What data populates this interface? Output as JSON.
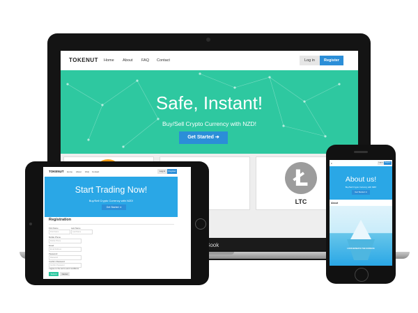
{
  "laptop": {
    "brand": "TOKENUT",
    "nav": [
      "Home",
      "About",
      "FAQ",
      "Contact"
    ],
    "login": "Log in",
    "register": "Register",
    "hero_title": "Safe, Instant!",
    "hero_subtitle": "Buy/Sell Crypto Currency with NZD!",
    "cta": "Get Started ➔",
    "coin_label": "LTC",
    "coin_glyph": "Ł",
    "bottom_text": "Book"
  },
  "tablet": {
    "brand": "TOKENUT",
    "nav": [
      "Home",
      "About",
      "FAQ",
      "Contact"
    ],
    "login": "Log in",
    "register": "Register",
    "hero_title": "Start Trading Now!",
    "hero_subtitle": "Buy/Sell Crypto Currency with NZD!",
    "cta": "Get Started ➔",
    "registration_title": "Registration",
    "fields": {
      "first_name_label": "First Name",
      "first_name_placeholder": "First Name",
      "last_name_label": "Last Name",
      "last_name_placeholder": "Last Name",
      "mobile_label": "Mobile Phone",
      "mobile_placeholder": "Mobile Phone",
      "email_label": "Email",
      "email_placeholder": "Email Address",
      "password_label": "Password",
      "password_placeholder": "Password",
      "confirm_label": "Confirm Password",
      "confirm_placeholder": "Confirm Password"
    },
    "terms": "I agree to the terms and conditions",
    "submit": "Submit",
    "cancel": "Cancel"
  },
  "phone": {
    "brand": "≡",
    "login": "Log in",
    "register": "Register",
    "hero_title": "About us!",
    "hero_subtitle": "Buy/Sell Crypto Currency with NZD!",
    "cta": "Get Started ➔",
    "section_title": "About",
    "promo_text": "LOOK BENEATH THE SURFACE"
  },
  "colors": {
    "laptop_hero": "#2ec8a0",
    "device_hero": "#2aa7e6",
    "accent_button": "#2b8ed8"
  }
}
